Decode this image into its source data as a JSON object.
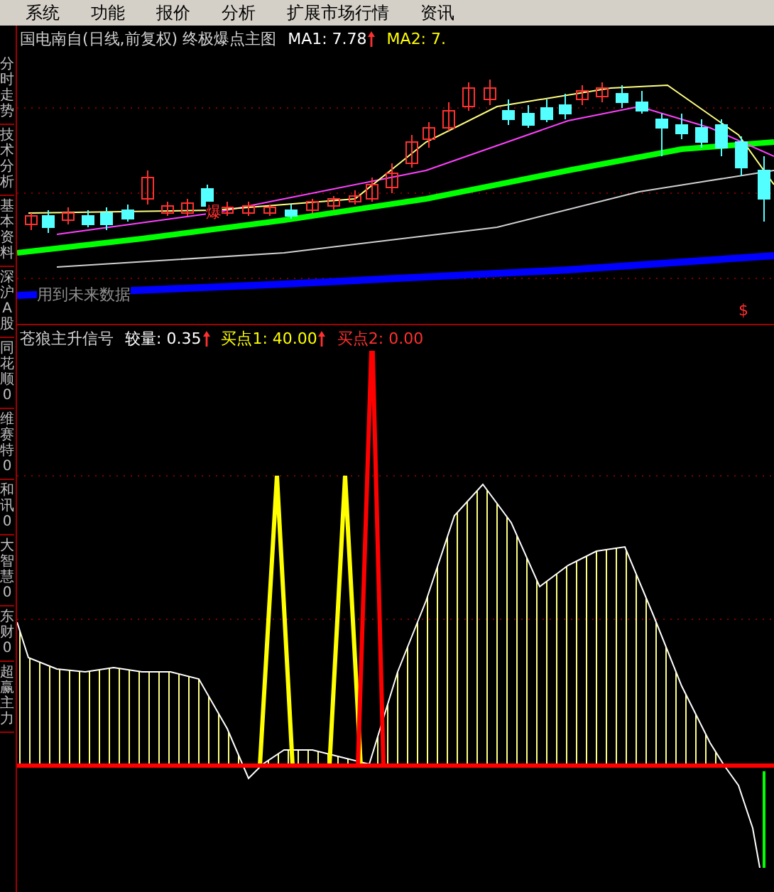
{
  "menu": [
    "系统",
    "功能",
    "报价",
    "分析",
    "扩展市场行情",
    "资讯"
  ],
  "sidebar": {
    "tabs": [
      {
        "label": "分时走势"
      },
      {
        "label": "技术分析"
      },
      {
        "label": "基本资料"
      },
      {
        "label": "深沪A股"
      },
      {
        "label": "同花顺0"
      },
      {
        "label": "维赛特0"
      },
      {
        "label": "和讯0"
      },
      {
        "label": "大智慧0"
      },
      {
        "label": "东财0"
      },
      {
        "label": "超赢主力"
      }
    ]
  },
  "main_chart": {
    "title": "国电南自(日线,前复权) 终极爆点主图",
    "indicators": [
      {
        "label": "MA1: 7.78",
        "color": "#ffffff",
        "arrow": true
      },
      {
        "label": "MA2: 7.",
        "color": "#ffff00",
        "arrow": false
      }
    ],
    "signal_label": "爆",
    "future_data_notice": "用到未来数据",
    "marker": "$"
  },
  "sub_chart": {
    "title": "苍狼主升信号",
    "indicators": [
      {
        "label": "较量: 0.35",
        "color": "#ffffff",
        "arrow": true
      },
      {
        "label": "买点1: 40.00",
        "color": "#ffff00",
        "arrow": true
      },
      {
        "label": "买点2: 0.00",
        "color": "#ff3030",
        "arrow": false
      }
    ]
  }
}
